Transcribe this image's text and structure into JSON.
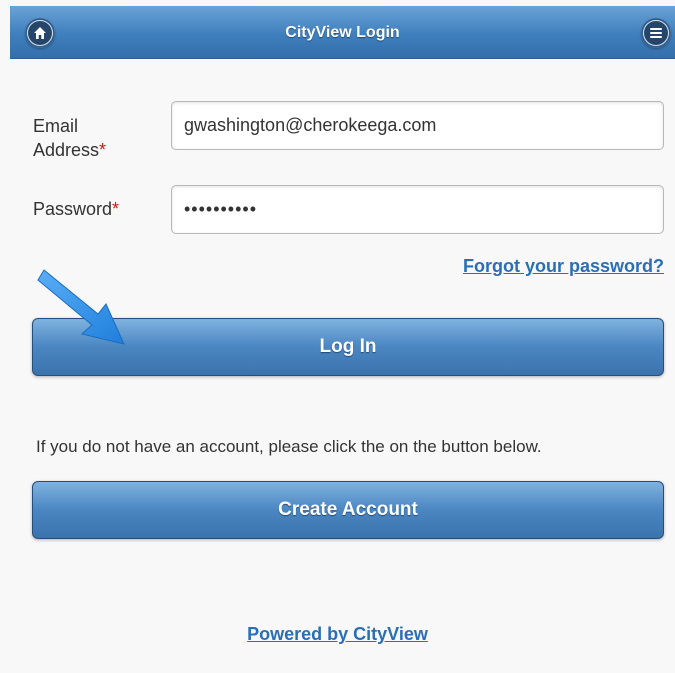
{
  "header": {
    "title": "CityView Login",
    "home_icon": "home-icon",
    "menu_icon": "menu-icon"
  },
  "form": {
    "email_label": "Email Address",
    "email_required": "*",
    "email_value": "gwashington@cherokeega.com",
    "password_label": "Password",
    "password_required": "*",
    "password_value": "••••••••••",
    "forgot_link": "Forgot your password?",
    "login_button": "Log In"
  },
  "signup": {
    "info_text": "If you do not have an account, please click the on the button below.",
    "create_button": "Create Account"
  },
  "footer": {
    "powered_by": "Powered by CityView"
  },
  "colors": {
    "accent": "#3f7fbd",
    "link": "#2a6fb6",
    "required": "#d01818",
    "annotation_arrow": "#2f8de4"
  }
}
